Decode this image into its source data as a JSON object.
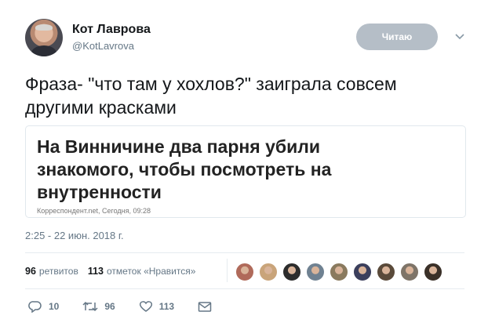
{
  "user": {
    "name": "Кот Лаврова",
    "handle": "@KotLavrova",
    "follow_label": "Читаю"
  },
  "tweet": {
    "text_line1": "Фраза- \"что там у хохлов?\" заиграла совсем",
    "text_line2": "другими красками",
    "timestamp": "2:25 - 22 июн. 2018 г."
  },
  "card": {
    "headline_line1": "На Винничине два парня убили",
    "headline_line2": "знакомого, чтобы посмотреть на",
    "headline_line3": "внутренности",
    "source": "Корреспондент.net, Сегодня, 09:28"
  },
  "stats": {
    "retweets_count": "96",
    "retweets_label": "ретвитов",
    "likes_count": "113",
    "likes_label": "отметок «Нравится»"
  },
  "liker_avatar_colors": [
    "#b06a5a",
    "#c9a47a",
    "#2c2c2c",
    "#6f8191",
    "#8a7a5e",
    "#3b3f5c",
    "#5a4a3a",
    "#7e7468",
    "#3a3028"
  ],
  "actions": {
    "replies": "10",
    "retweets": "96",
    "likes": "113"
  },
  "icons": {
    "reply": "reply-icon",
    "retweet": "retweet-icon",
    "like": "heart-icon",
    "dm": "envelope-icon",
    "caret": "chevron-down-icon"
  }
}
